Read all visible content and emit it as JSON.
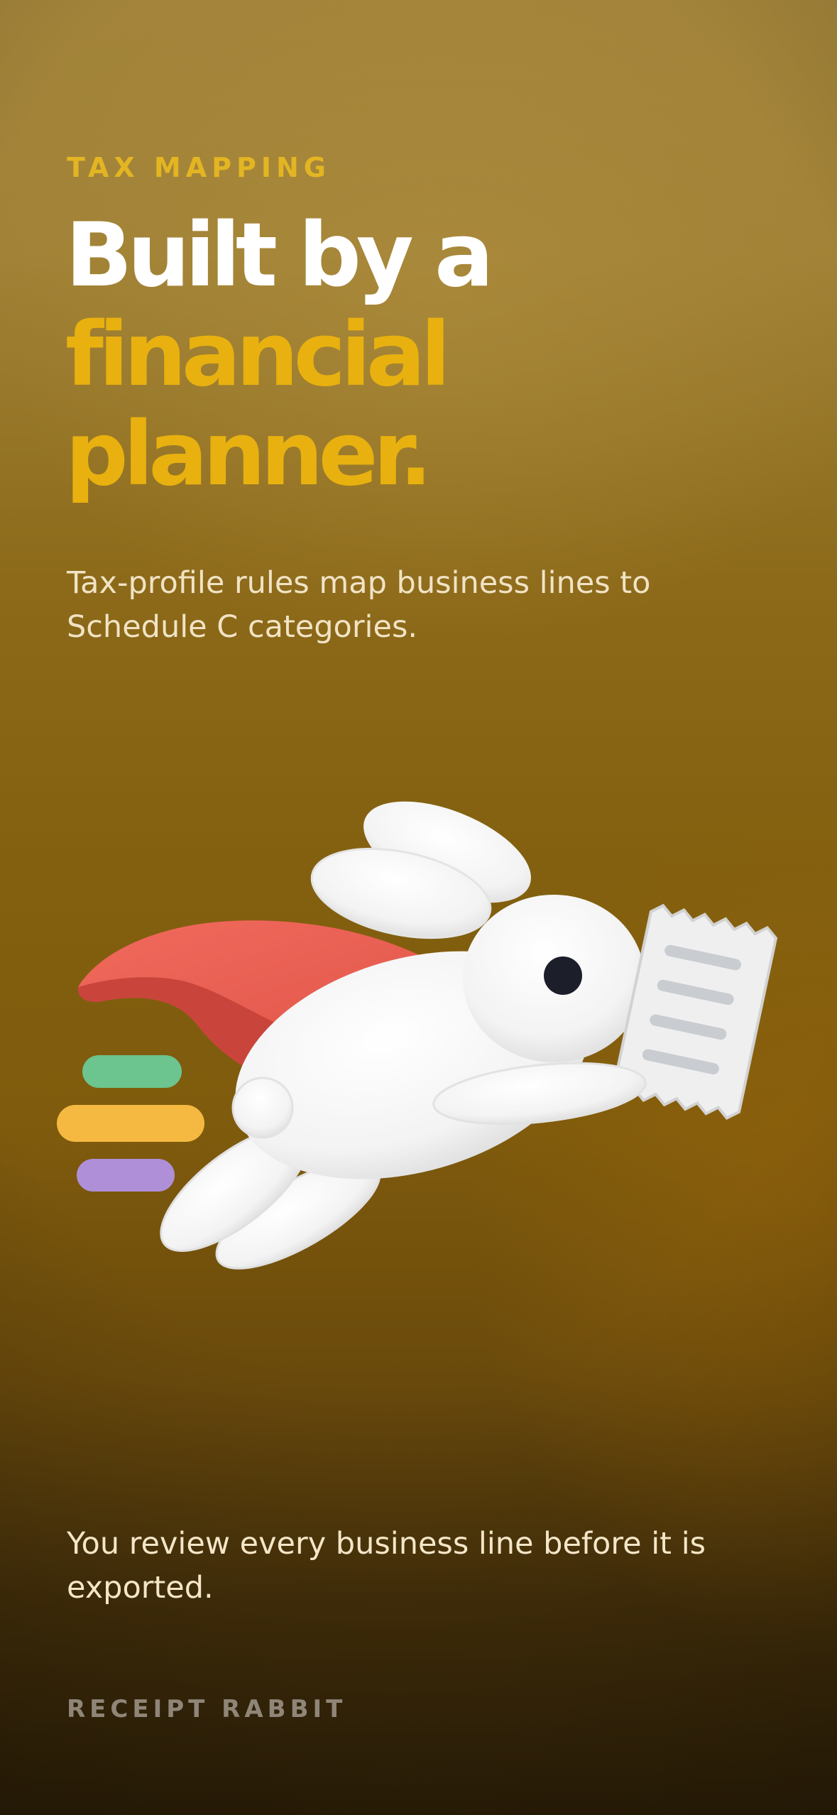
{
  "onboarding": {
    "eyebrow": "TAX MAPPING",
    "headline": {
      "line1": "Built by a",
      "line2": "financial",
      "line3": "planner."
    },
    "subtitle": "Tax-profile rules map business lines to Schedule C categories.",
    "footnote": "You review every business line before it is exported.",
    "brand": "RECEIPT RABBIT"
  },
  "illustration": {
    "icon": "flying-rabbit-with-receipt",
    "colors": {
      "cape": "#ea5f52",
      "rabbit": "#f7f7f7",
      "speed_line_green": "#6cc48f",
      "speed_line_yellow": "#f5b942",
      "speed_line_purple": "#ae8fd8",
      "receipt": "#eeeeee"
    }
  },
  "theme": {
    "accent": "#e8b10f",
    "background_top": "#a3843a",
    "background_bottom": "#2f2108"
  }
}
